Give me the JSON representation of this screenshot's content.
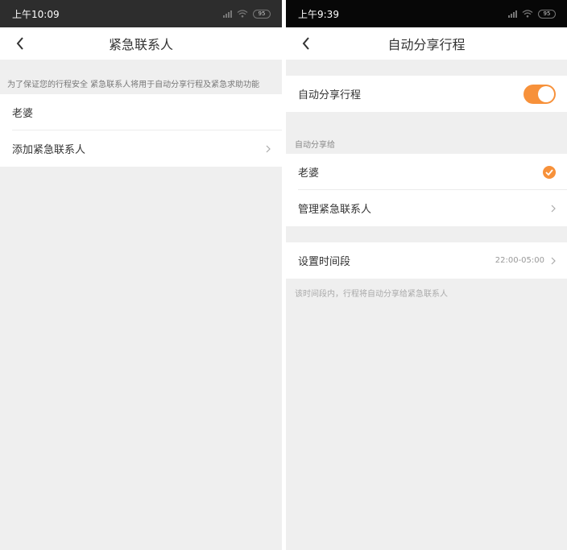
{
  "colors": {
    "accent": "#f7913a",
    "statusbar_left": "#2d2d2d",
    "statusbar_right": "#070707"
  },
  "left": {
    "statusbar": {
      "time": "上午10:09",
      "battery": "95"
    },
    "navbar": {
      "title": "紧急联系人"
    },
    "notice": "为了保证您的行程安全 紧急联系人将用于自动分享行程及紧急求助功能",
    "contacts": [
      {
        "name": "老婆"
      }
    ],
    "add_contact_label": "添加紧急联系人"
  },
  "right": {
    "statusbar": {
      "time": "上午9:39",
      "battery": "95"
    },
    "navbar": {
      "title": "自动分享行程"
    },
    "auto_share": {
      "label": "自动分享行程",
      "enabled": true
    },
    "share_to_label": "自动分享给",
    "contacts": [
      {
        "name": "老婆",
        "selected": true
      }
    ],
    "manage_contacts_label": "管理紧急联系人",
    "time_period": {
      "label": "设置时间段",
      "value": "22:00-05:00"
    },
    "footnote": "该时间段内，行程将自动分享给紧急联系人"
  },
  "icons": {
    "back": "back-arrow-icon",
    "chevron": "chevron-right-icon",
    "check": "check-circle-icon",
    "signal": "signal-icon",
    "wifi": "wifi-icon",
    "battery": "battery-icon"
  }
}
